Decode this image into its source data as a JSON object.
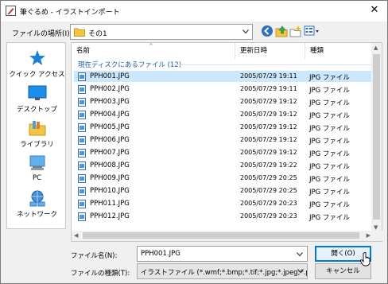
{
  "window": {
    "title": "筆ぐるめ - イラストインポート",
    "close_symbol": "✕"
  },
  "location": {
    "label": "ファイルの場所(I):",
    "value": "その1"
  },
  "toolbar": {
    "icons": [
      "back-icon",
      "up-folder-icon",
      "new-folder-icon",
      "view-menu-icon"
    ]
  },
  "places": [
    {
      "label": "クイック アクセス",
      "icon": "quick-access-star-icon"
    },
    {
      "label": "デスクトップ",
      "icon": "desktop-icon"
    },
    {
      "label": "ライブラリ",
      "icon": "libraries-icon"
    },
    {
      "label": "PC",
      "icon": "pc-icon"
    },
    {
      "label": "ネットワーク",
      "icon": "network-icon"
    }
  ],
  "list": {
    "columns": {
      "name": "名前",
      "date": "更新日時",
      "type": "種類"
    },
    "group": "現在ディスクにあるファイル (12)",
    "files": [
      {
        "name": "PPH001.JPG",
        "date": "2005/07/29 19:11",
        "type": "JPG ファイル",
        "selected": true
      },
      {
        "name": "PPH002.JPG",
        "date": "2005/07/29 19:11",
        "type": "JPG ファイル"
      },
      {
        "name": "PPH003.JPG",
        "date": "2005/07/29 19:12",
        "type": "JPG ファイル"
      },
      {
        "name": "PPH004.JPG",
        "date": "2005/07/29 19:12",
        "type": "JPG ファイル"
      },
      {
        "name": "PPH005.JPG",
        "date": "2005/07/29 19:12",
        "type": "JPG ファイル"
      },
      {
        "name": "PPH006.JPG",
        "date": "2005/07/29 19:12",
        "type": "JPG ファイル"
      },
      {
        "name": "PPH007.JPG",
        "date": "2005/07/29 19:12",
        "type": "JPG ファイル"
      },
      {
        "name": "PPH008.JPG",
        "date": "2005/07/29 19:22",
        "type": "JPG ファイル"
      },
      {
        "name": "PPH009.JPG",
        "date": "2005/07/29 20:25",
        "type": "JPG ファイル"
      },
      {
        "name": "PPH010.JPG",
        "date": "2005/07/29 20:25",
        "type": "JPG ファイル"
      },
      {
        "name": "PPH011.JPG",
        "date": "2005/07/29 20:23",
        "type": "JPG ファイル"
      },
      {
        "name": "PPH012.JPG",
        "date": "2005/07/29 20:23",
        "type": "JPG ファイル"
      }
    ]
  },
  "filename": {
    "label": "ファイル名(N):",
    "value": "PPH001.JPG"
  },
  "filetype": {
    "label": "ファイルの種類(T):",
    "value": "イラストファイル (*.wmf;*.bmp;*.tif;*.jpg;*.jpeg;*.pcd;*"
  },
  "buttons": {
    "open": "開く(O)",
    "cancel": "キャンセル"
  },
  "colors": {
    "accent": "#0078d7",
    "selection": "#cce8ff",
    "group_text": "#1e5aa8"
  }
}
